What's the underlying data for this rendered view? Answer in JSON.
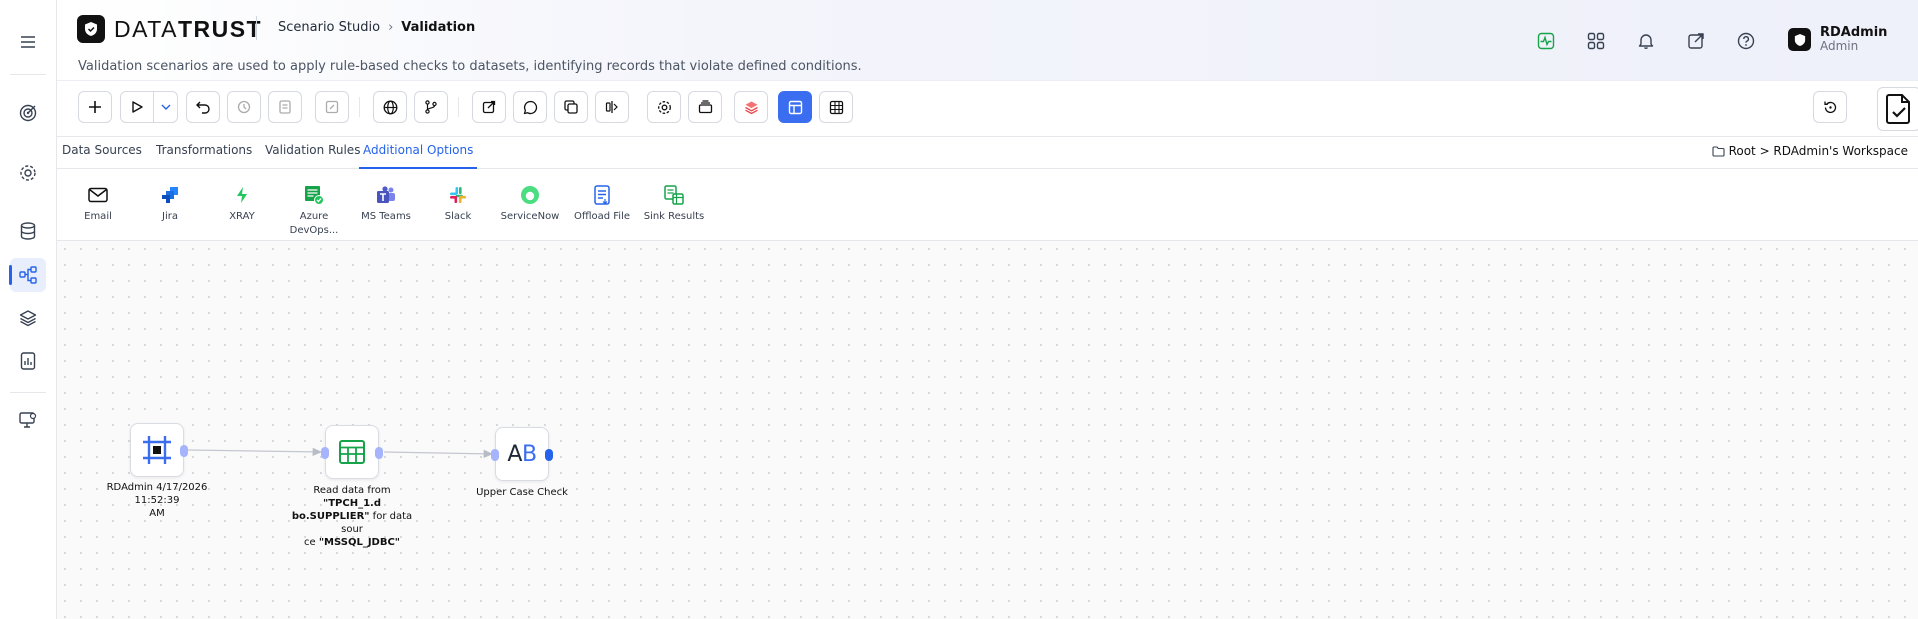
{
  "app": {
    "brand_first": "DATA",
    "brand_second": "TRUST",
    "breadcrumb": [
      "Scenario Studio",
      "Validation"
    ],
    "description": "Validation scenarios are used to apply rule-based checks to datasets, identifying records that violate defined conditions."
  },
  "header_icons": [
    "activity-icon",
    "apps-grid-icon",
    "bell-icon",
    "external-link-icon",
    "help-icon"
  ],
  "user": {
    "name": "RDAdmin",
    "role": "Admin"
  },
  "rail": [
    "menu-icon",
    "target-icon",
    "settings-icon",
    "database-icon",
    "workflow-icon",
    "layers-icon",
    "report-icon",
    "monitor-settings-icon"
  ],
  "toolbar_icons": [
    "add-icon",
    "run-icon",
    "run-options-icon",
    "undo-icon",
    "history-icon",
    "audit-icon",
    "edit-icon",
    "globe-icon",
    "branch-icon",
    "open-external-icon",
    "comment-icon",
    "duplicate-icon",
    "align-icon",
    "settings-icon",
    "archive-icon",
    "layers-icon",
    "layout-icon",
    "table-icon",
    "restore-icon",
    "validation-document-icon"
  ],
  "tabs": [
    {
      "label": "Data Sources"
    },
    {
      "label": "Transformations"
    },
    {
      "label": "Validation Rules"
    },
    {
      "label": "Additional Options",
      "active": true
    }
  ],
  "workspace_path": "Root > RDAdmin's Workspace",
  "palette": [
    {
      "label": "Email"
    },
    {
      "label": "Jira"
    },
    {
      "label": "XRAY"
    },
    {
      "label": "Azure",
      "label2": "DevOps..."
    },
    {
      "label": "MS Teams"
    },
    {
      "label": "Slack"
    },
    {
      "label": "ServiceNow"
    },
    {
      "label": "Offload File"
    },
    {
      "label": "Sink Results"
    }
  ],
  "nodes": [
    {
      "id": "start",
      "label_lines": [
        "RDAdmin 4/17/2026 11:52:39",
        "AM"
      ]
    },
    {
      "id": "read",
      "label_parts": {
        "l1a": "Read data from ",
        "l1b": "\"TPCH_1.d",
        "l2a": "bo.SUPPLIER\"",
        "l2b": " for data sour",
        "l3a": "ce ",
        "l3b": "\"MSSQL_JDBC\""
      }
    },
    {
      "id": "rule",
      "label_lines": [
        "Upper Case Check"
      ]
    }
  ],
  "colors": {
    "accent": "#2563eb",
    "primary_button": "#3b6df0",
    "green": "#16a34a"
  }
}
